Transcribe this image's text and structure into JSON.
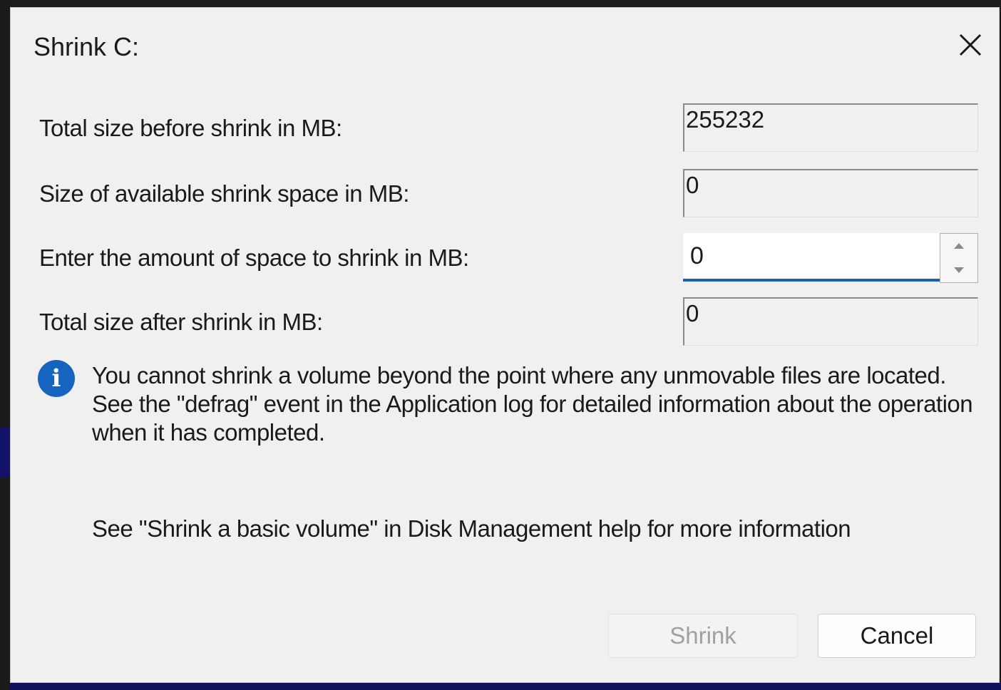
{
  "dialog": {
    "title": "Shrink C:",
    "close_icon": "close-icon"
  },
  "fields": {
    "total_before_label": "Total size before shrink in MB:",
    "total_before_value": "255232",
    "available_label": "Size of available shrink space in MB:",
    "available_value": "0",
    "amount_label": "Enter the amount of space to shrink in MB:",
    "amount_value": "0",
    "total_after_label": "Total size after shrink in MB:",
    "total_after_value": "0"
  },
  "info": {
    "icon": "info-icon",
    "message": "You cannot shrink a volume beyond the point where any unmovable files are located. See the \"defrag\" event in the Application log for detailed information about the operation when it has completed.",
    "help": "See \"Shrink a basic volume\" in Disk Management help for more information"
  },
  "buttons": {
    "shrink_label": "Shrink",
    "shrink_enabled": false,
    "cancel_label": "Cancel"
  },
  "colors": {
    "dialog_bg": "#f0f0f0",
    "accent": "#1a5fb4",
    "info_blue": "#1565c0",
    "disabled_text": "#a0a0a0"
  }
}
